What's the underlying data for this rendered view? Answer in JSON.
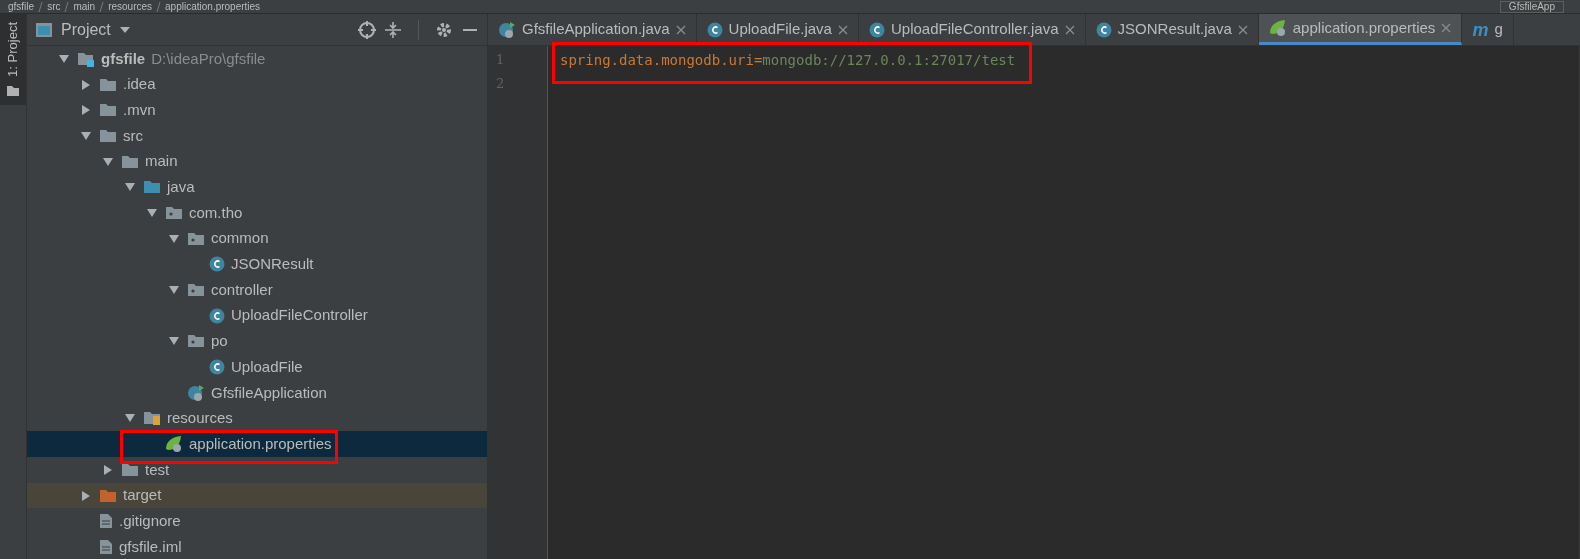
{
  "breadcrumb": {
    "items": [
      "gfsfile",
      "src",
      "main",
      "resources",
      "application.properties"
    ],
    "run_config": "GfsfileApp"
  },
  "side_strip": {
    "label": "1: Project"
  },
  "project_panel": {
    "title": "Project"
  },
  "tree": [
    {
      "label": "gfsfile",
      "path": "D:\\ideaPro\\gfsfile",
      "kind": "module",
      "expanded": true,
      "selected": false,
      "children": [
        {
          "label": ".idea",
          "kind": "folder",
          "expanded": false,
          "selected": false
        },
        {
          "label": ".mvn",
          "kind": "folder",
          "expanded": false,
          "selected": false
        },
        {
          "label": "src",
          "kind": "folder",
          "expanded": true,
          "selected": false,
          "children": [
            {
              "label": "main",
              "kind": "folder",
              "expanded": true,
              "selected": false,
              "children": [
                {
                  "label": "java",
                  "kind": "source",
                  "expanded": true,
                  "selected": false,
                  "children": [
                    {
                      "label": "com.tho",
                      "kind": "package",
                      "expanded": true,
                      "selected": false,
                      "children": [
                        {
                          "label": "common",
                          "kind": "package",
                          "expanded": true,
                          "selected": false,
                          "children": [
                            {
                              "label": "JSONResult",
                              "kind": "class",
                              "selected": false
                            }
                          ]
                        },
                        {
                          "label": "controller",
                          "kind": "package",
                          "expanded": true,
                          "selected": false,
                          "children": [
                            {
                              "label": "UploadFileController",
                              "kind": "class",
                              "selected": false
                            }
                          ]
                        },
                        {
                          "label": "po",
                          "kind": "package",
                          "expanded": true,
                          "selected": false,
                          "children": [
                            {
                              "label": "UploadFile",
                              "kind": "class",
                              "selected": false
                            }
                          ]
                        },
                        {
                          "label": "GfsfileApplication",
                          "kind": "spring-app",
                          "selected": false
                        }
                      ]
                    }
                  ]
                },
                {
                  "label": "resources",
                  "kind": "resources",
                  "expanded": true,
                  "selected": false,
                  "children": [
                    {
                      "label": "application.properties",
                      "kind": "properties",
                      "selected": true
                    }
                  ]
                }
              ]
            },
            {
              "label": "test",
              "kind": "folder",
              "expanded": false,
              "selected": false
            }
          ]
        },
        {
          "label": "target",
          "kind": "excluded",
          "expanded": false,
          "selected": false
        },
        {
          "label": ".gitignore",
          "kind": "file",
          "selected": false
        },
        {
          "label": "gfsfile.iml",
          "kind": "file",
          "selected": false
        }
      ]
    }
  ],
  "tabs": [
    {
      "label": "GfsfileApplication.java",
      "kind": "spring-app",
      "selected": false
    },
    {
      "label": "UploadFile.java",
      "kind": "class",
      "selected": false
    },
    {
      "label": "UploadFileController.java",
      "kind": "class",
      "selected": false
    },
    {
      "label": "JSONResult.java",
      "kind": "class",
      "selected": false
    },
    {
      "label": "application.properties",
      "kind": "properties",
      "selected": true
    },
    {
      "label": "g",
      "kind": "maven",
      "icon_letter": "m",
      "selected": false
    }
  ],
  "editor": {
    "lines": [
      {
        "number": "1",
        "key": "spring.data.mongodb.uri",
        "sep": "=",
        "value": "mongodb://127.0.0.1:27017/test"
      },
      {
        "number": "2"
      }
    ]
  }
}
